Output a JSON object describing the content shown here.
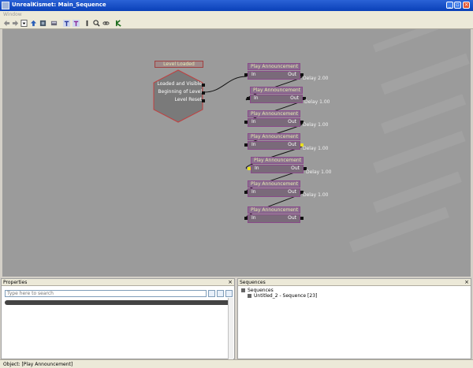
{
  "window": {
    "title": "UnrealKismet: Main_Sequence"
  },
  "menu": {
    "items": [
      "Window"
    ]
  },
  "toolbar": {
    "icons": [
      "back-arrow-icon",
      "forward-arrow-icon",
      "dropdown-icon",
      "up-arrow-icon",
      "parent-sequence-icon",
      "open-icon",
      "text-icon",
      "text-alt-icon",
      "search-icon",
      "zoom-icon",
      "link-icon",
      "k-icon"
    ]
  },
  "canvas": {
    "level_loaded": {
      "title": "Level Loaded",
      "outputs": [
        "Loaded and Visible",
        "Beginning of Level",
        "Level Reset"
      ]
    },
    "nodes": [
      {
        "title": "Play Announcement",
        "in": "In",
        "out": "Out",
        "delay": "Delay 2.00"
      },
      {
        "title": "Play Announcement",
        "in": "In",
        "out": "Out",
        "delay": "Delay 1.00"
      },
      {
        "title": "Play Announcement",
        "in": "In",
        "out": "Out",
        "delay": "Delay 1.00"
      },
      {
        "title": "Play Announcement",
        "in": "In",
        "out": "Out",
        "delay": "Delay 1.00"
      },
      {
        "title": "Play Announcement",
        "in": "In",
        "out": "Out",
        "delay": "Delay 1.00"
      },
      {
        "title": "Play Announcement",
        "in": "In",
        "out": "Out",
        "delay": "Delay 1.00"
      },
      {
        "title": "Play Announcement",
        "in": "In",
        "out": "Out",
        "delay": ""
      }
    ]
  },
  "properties": {
    "title": "Properties",
    "search_placeholder": "Type here to search"
  },
  "sequences": {
    "title": "Sequences",
    "root": "Sequences",
    "item": "Untitled_2 - Sequence [23]"
  },
  "status": {
    "text": "Object: [Play Announcement]"
  }
}
